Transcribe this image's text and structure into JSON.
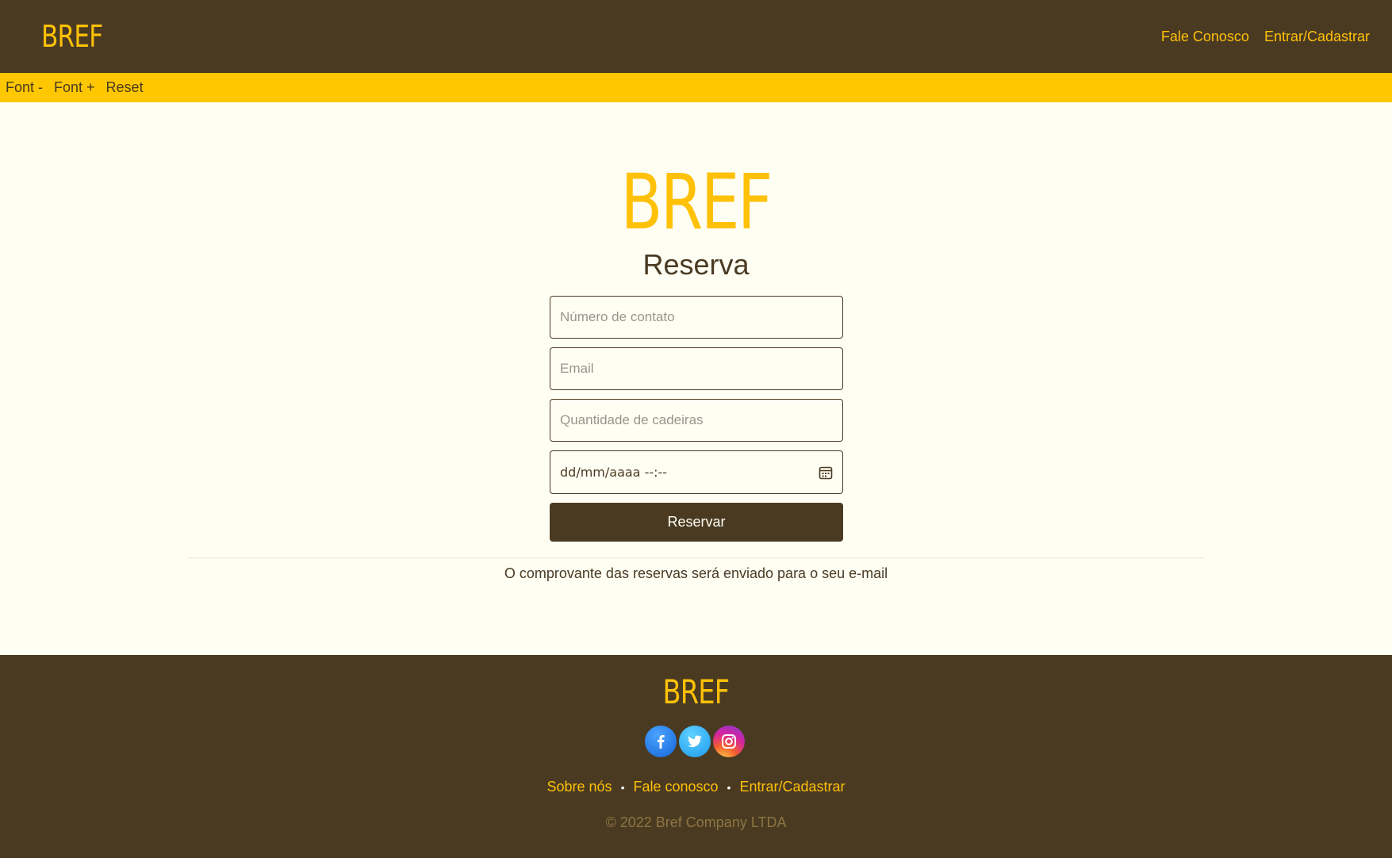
{
  "header": {
    "brand": "BREF",
    "nav": [
      {
        "label": "Fale Conosco"
      },
      {
        "label": "Entrar/Cadastrar"
      }
    ]
  },
  "accessibility": {
    "font_minus": "Font -",
    "font_plus": "Font +",
    "reset": "Reset"
  },
  "main": {
    "brand": "BREF",
    "heading": "Reserva",
    "form": {
      "phone_placeholder": "Número de contato",
      "email_placeholder": "Email",
      "chairs_placeholder": "Quantidade de cadeiras",
      "datetime_value": "dd/mm/aaaa --:--",
      "datetime_icon": "calendar-icon",
      "submit_label": "Reservar"
    },
    "note": "O comprovante das reservas será enviado para o seu e-mail"
  },
  "footer": {
    "brand": "BREF",
    "socials": [
      "facebook-icon",
      "twitter-icon",
      "instagram-icon"
    ],
    "links": [
      {
        "label": "Sobre nós"
      },
      {
        "label": "Fale conosco"
      },
      {
        "label": "Entrar/Cadastrar"
      }
    ],
    "separator": "•",
    "copyright": "© 2022 Bref Company LTDA"
  },
  "colors": {
    "brown": "#4a3a22",
    "yellow": "#ffc107",
    "cream": "#fffef3"
  }
}
